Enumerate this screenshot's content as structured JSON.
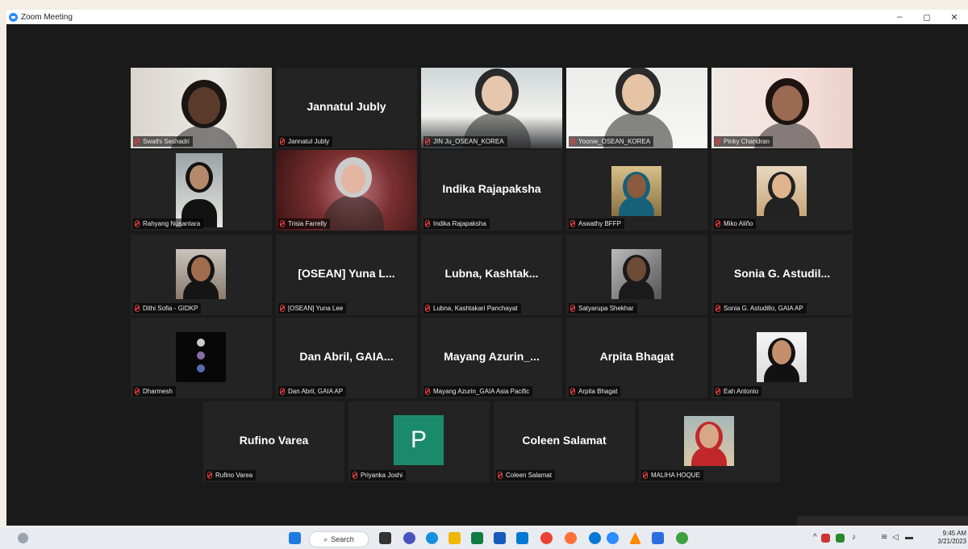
{
  "window": {
    "title": "Zoom Meeting",
    "controls": [
      "–",
      "◻",
      "✕"
    ]
  },
  "participants": [
    {
      "name": "Swathi Seshadri",
      "video": true
    },
    {
      "name": "Jannatul Jubly",
      "display": "Jannatul Jubly",
      "video": false
    },
    {
      "name": "JIN Ju_OSEAN_KOREA",
      "video": true
    },
    {
      "name": "Yoonie_OSEAN_KOREA",
      "video": true
    },
    {
      "name": "Pinky Chandran",
      "video": true
    },
    {
      "name": "Rahyang Nusantara",
      "video": true
    },
    {
      "name": "Trisia Farrelly",
      "video": true,
      "active_speaker": true
    },
    {
      "name": "Indika Rajapaksha",
      "display": "Indika Rajapaksha",
      "video": false
    },
    {
      "name": "Aswathy BFFP",
      "video": true
    },
    {
      "name": "Miko Aliño",
      "video": true
    },
    {
      "name": "Dithi Sofia - GIDKP",
      "video": true
    },
    {
      "name": "[OSEAN] Yuna Lee",
      "display": "[OSEAN] Yuna L...",
      "video": false
    },
    {
      "name": "Lubna, Kashtakari Panchayat",
      "display": "Lubna,  Kashtak...",
      "video": false
    },
    {
      "name": "Satyarupa Shekhar",
      "video": true
    },
    {
      "name": "Sonia G. Astudillo, GAIA AP",
      "display": "Sonia G. Astudil...",
      "video": false
    },
    {
      "name": "Dharmesh",
      "video": true
    },
    {
      "name": "Dan Abril, GAIA AP",
      "display": "Dan Abril, GAIA...",
      "video": false
    },
    {
      "name": "Mayang Azurin_GAIA Asia Pacific",
      "display": "Mayang  Azurin_...",
      "video": false
    },
    {
      "name": "Arpita Bhagat",
      "display": "Arpita Bhagat",
      "video": false
    },
    {
      "name": "Eah Antonio",
      "video": true
    },
    {
      "name": "Rufino Varea",
      "display": "Rufino Varea",
      "video": false
    },
    {
      "name": "Priyanka Joshi",
      "avatar_letter": "P",
      "video": false
    },
    {
      "name": "Coleen Salamat",
      "display": "Coleen Salamat",
      "video": false
    },
    {
      "name": "MALIHA HOQUE",
      "video": true
    }
  ],
  "taskbar": {
    "search_label": "Search",
    "time": "9:45 AM",
    "date": "3/21/2023"
  },
  "colors": {
    "meeting_bg": "#1a1a1a",
    "tile_bg": "#232323",
    "active_speaker_border": "#c8d75a",
    "avatar_bg": "#1b8a6b",
    "zoom_blue": "#2d8cff"
  }
}
